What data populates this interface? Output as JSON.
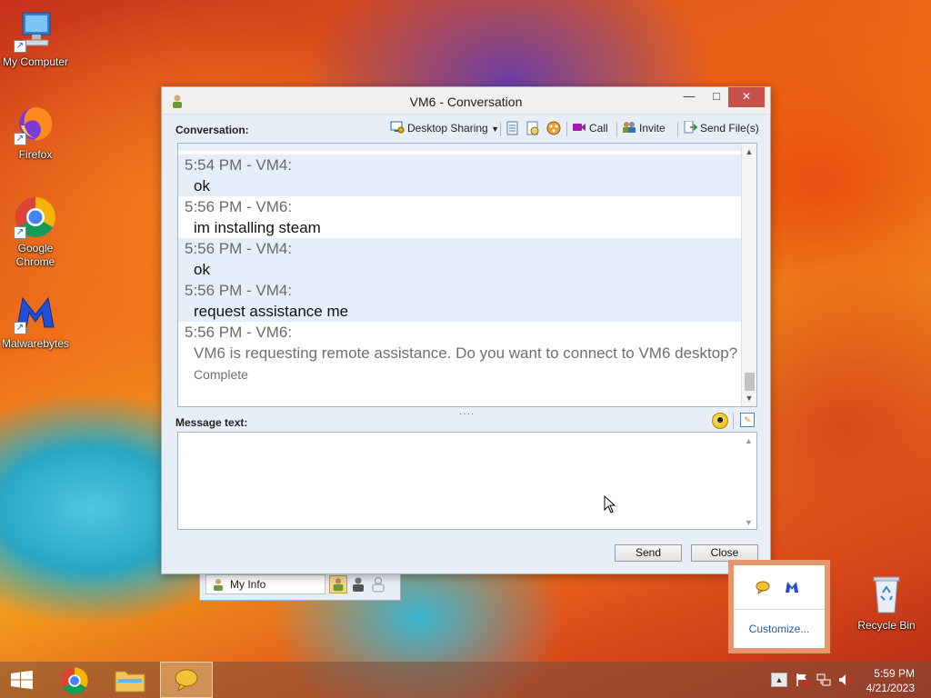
{
  "desktop": {
    "icons": [
      {
        "label": "My Computer",
        "icon": "computer-icon"
      },
      {
        "label": "Firefox",
        "icon": "firefox-icon"
      },
      {
        "label": "Google Chrome",
        "icon": "chrome-icon"
      },
      {
        "label": "Malwarebytes",
        "icon": "malwarebytes-icon"
      },
      {
        "label": "Recycle Bin",
        "icon": "recycle-bin-icon"
      }
    ]
  },
  "window": {
    "title": "VM6 - Conversation",
    "conversation_label": "Conversation:",
    "toolbar": {
      "desktop_sharing": "Desktop Sharing",
      "call": "Call",
      "invite": "Invite",
      "send_files": "Send File(s)"
    },
    "messages": [
      {
        "header": "5:54 PM - VM4:",
        "body": "ok"
      },
      {
        "header": "5:56 PM - VM6:",
        "body": "im installing steam"
      },
      {
        "header": "5:56 PM - VM4:",
        "body": "ok"
      },
      {
        "header": "5:56 PM - VM4:",
        "body": "request assistance me"
      },
      {
        "header": "5:56 PM - VM6:",
        "body": "VM6 is requesting remote assistance. Do you want to connect to VM6 desktop?",
        "status": "Complete"
      }
    ],
    "message_text_label": "Message text:",
    "message_input_value": "",
    "send_label": "Send",
    "close_label": "Close"
  },
  "messenger_bar": {
    "my_info_label": "My Info"
  },
  "tray_popup": {
    "customize_label": "Customize..."
  },
  "taskbar": {
    "time": "5:59 PM",
    "date": "4/21/2023"
  },
  "colors": {
    "titlebar": "#f0f0f0",
    "close_button": "#c7504a",
    "chat_alt_row": "#e6eefa",
    "link_blue": "#1d5fa8"
  }
}
